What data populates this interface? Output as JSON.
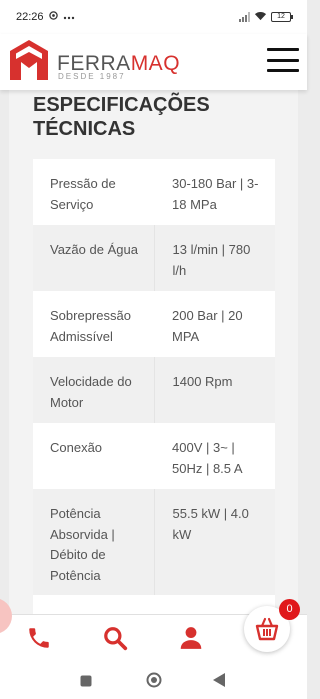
{
  "status_bar": {
    "time": "22:26",
    "battery": "12"
  },
  "header": {
    "brand_part1": "FERRA",
    "brand_part2": "MAQ",
    "tagline": "DESDE 1987"
  },
  "section": {
    "title": "ESPECIFICAÇÕES TÉCNICAS"
  },
  "specs": {
    "rows": [
      {
        "label": "Pressão de Serviço",
        "value": "30-180 Bar | 3-18 MPa"
      },
      {
        "label": "Vazão de Água",
        "value": "13 l/min | 780 l/h"
      },
      {
        "label": "Sobrepressão Admissível",
        "value": "200 Bar | 20 MPA"
      },
      {
        "label": "Velocidade do Motor",
        "value": "1400 Rpm"
      },
      {
        "label": "Conexão",
        "value": "400V | 3~ | 50Hz | 8.5 A"
      },
      {
        "label": "Potência Absorvida | Débito de Potência",
        "value": "55.5 kW | 4.0 kW"
      }
    ]
  },
  "cart": {
    "count": "0"
  },
  "colors": {
    "accent": "#d7312e",
    "badge": "#e0181b"
  },
  "icons": {
    "bottom_nav": [
      "phone-icon",
      "search-icon",
      "user-icon",
      "cart-icon"
    ],
    "android_nav": [
      "recents-icon",
      "home-icon",
      "back-icon"
    ]
  }
}
